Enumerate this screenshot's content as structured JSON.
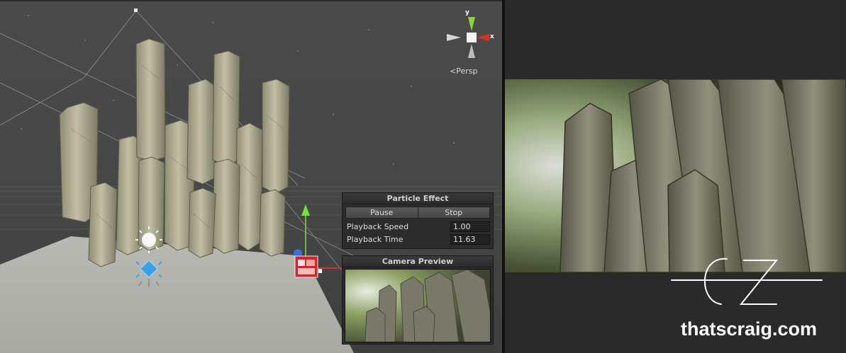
{
  "scene_view": {
    "gizmo": {
      "y_label": "y",
      "x_label": "x",
      "projection_label": "Persp"
    }
  },
  "particle_effect": {
    "title": "Particle Effect",
    "pause_label": "Pause",
    "stop_label": "Stop",
    "speed_label": "Playback Speed",
    "speed_value": "1.00",
    "time_label": "Playback Time",
    "time_value": "11.63"
  },
  "camera_preview": {
    "title": "Camera Preview"
  },
  "branding": {
    "logo_letters": "CZ",
    "site": "thatscraig.com"
  },
  "colors": {
    "gizmo_y": "#8cd43a",
    "gizmo_x": "#e0301e",
    "gizmo_z": "#cfcfcf",
    "move_y": "#74e03a",
    "move_x": "#e03b2a",
    "move_z": "#3a6fe0",
    "ground": "#b8b8b2",
    "rock": "#a8a68c"
  }
}
